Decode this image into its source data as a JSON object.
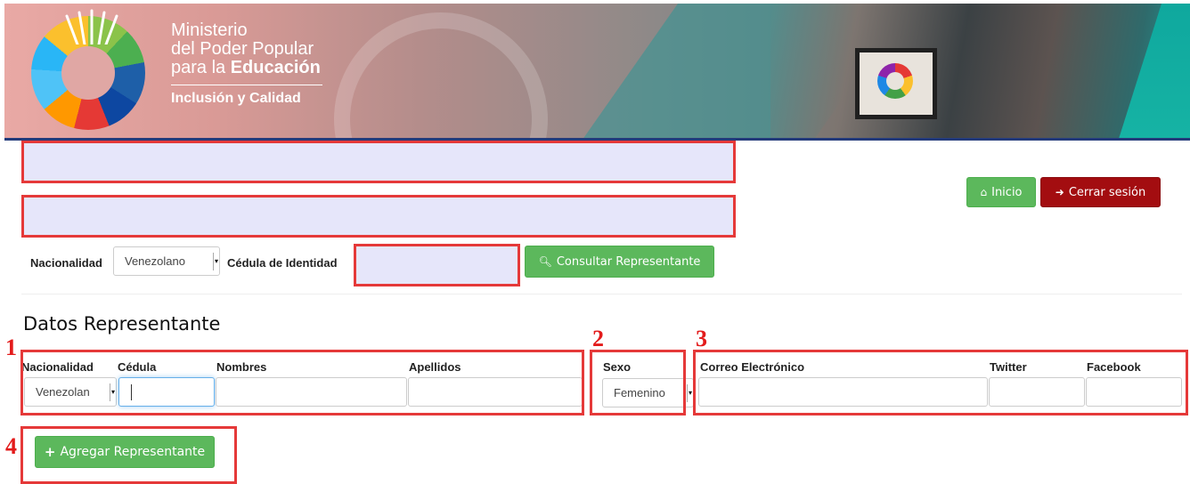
{
  "banner": {
    "ministry_line1": "Ministerio",
    "ministry_line2": "del Poder Popular",
    "ministry_line3_prefix": "para la ",
    "ministry_line3_bold": "Educación",
    "tagline": "Inclusión y Calidad"
  },
  "nav": {
    "home_label": "Inicio",
    "logout_label": "Cerrar sesión"
  },
  "search": {
    "nationality_label": "Nacionalidad",
    "nationality_value": "Venezolano",
    "id_label": "Cédula de Identidad",
    "consult_label": "Consultar Representante"
  },
  "section": {
    "title": "Datos Representante"
  },
  "form": {
    "nationality_label": "Nacionalidad",
    "nationality_value": "Venezolan",
    "id_label": "Cédula",
    "names_label": "Nombres",
    "surnames_label": "Apellidos",
    "sex_label": "Sexo",
    "sex_value": "Femenino",
    "email_label": "Correo Electrónico",
    "twitter_label": "Twitter",
    "facebook_label": "Facebook"
  },
  "actions": {
    "add_label": "Agregar Representante"
  },
  "annotations": {
    "n1": "1",
    "n2": "2",
    "n3": "3",
    "n4": "4"
  },
  "colors": {
    "accent_green": "#5cb85c",
    "accent_red": "#a30d10",
    "annotation_red": "#e53939",
    "banner_underline": "#233a7a"
  }
}
